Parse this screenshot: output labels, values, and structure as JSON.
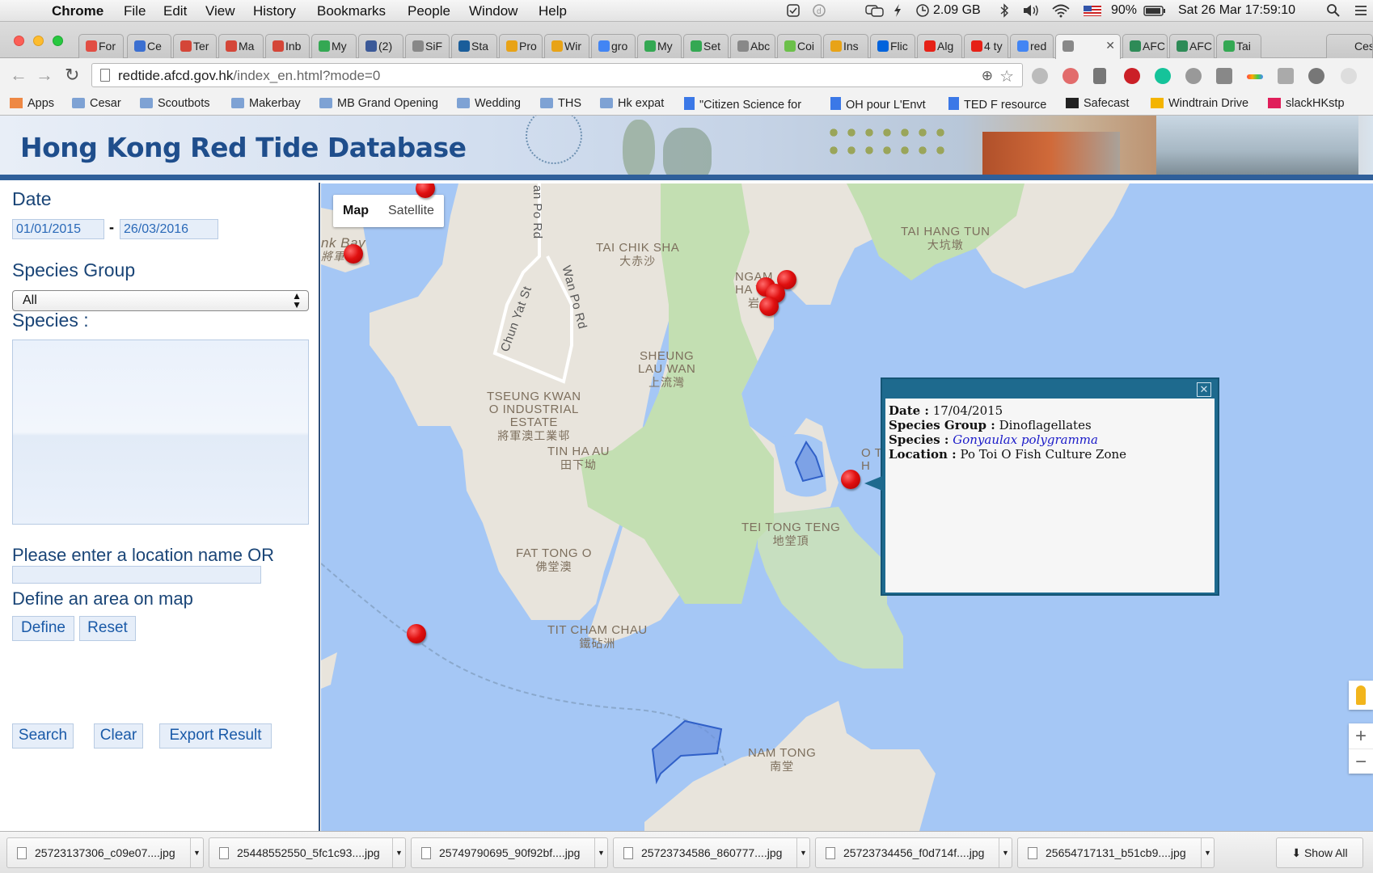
{
  "menubar": {
    "app": "Chrome",
    "items": [
      "File",
      "Edit",
      "View",
      "History",
      "Bookmarks",
      "People",
      "Window",
      "Help"
    ],
    "memory": "2.09 GB",
    "battery": "90%",
    "datetime": "Sat 26 Mar  17:59:10"
  },
  "tabs": [
    {
      "label": "For",
      "color": "#e14d43"
    },
    {
      "label": "Ce",
      "color": "#3b6fd1"
    },
    {
      "label": "Ter",
      "color": "#d44638"
    },
    {
      "label": "Ma",
      "color": "#d44638"
    },
    {
      "label": "Inb",
      "color": "#d44638"
    },
    {
      "label": "My",
      "color": "#34a853"
    },
    {
      "label": "(2)",
      "color": "#3b5998"
    },
    {
      "label": "SiF",
      "color": "#888888"
    },
    {
      "label": "Sta",
      "color": "#1a5d9a"
    },
    {
      "label": "Pro",
      "color": "#e8a317"
    },
    {
      "label": "Wir",
      "color": "#e8a317"
    },
    {
      "label": "gro",
      "color": "#4285f4"
    },
    {
      "label": "My",
      "color": "#34a853"
    },
    {
      "label": "Set",
      "color": "#34a853"
    },
    {
      "label": "Abc",
      "color": "#888888"
    },
    {
      "label": "Coi",
      "color": "#6cc04a"
    },
    {
      "label": "Ins",
      "color": "#e8a317"
    },
    {
      "label": "Flic",
      "color": "#0063dc"
    },
    {
      "label": "Alg",
      "color": "#e62117"
    },
    {
      "label": "4 ty",
      "color": "#e62117"
    },
    {
      "label": "red",
      "color": "#4285f4"
    },
    {
      "label": "",
      "color": "#888888",
      "active": true
    },
    {
      "label": "AFC",
      "color": "#2e8b57"
    },
    {
      "label": "AFC",
      "color": "#2e8b57"
    },
    {
      "label": "Tai",
      "color": "#34a853"
    }
  ],
  "tab_overflow_label": "Ces",
  "toolbar": {
    "url_host": "redtide.afcd.gov.hk",
    "url_path": "/index_en.html?mode=0"
  },
  "bookmarks": [
    {
      "label": "Apps",
      "type": "apps"
    },
    {
      "label": "Cesar",
      "type": "folder"
    },
    {
      "label": "Scoutbots",
      "type": "folder"
    },
    {
      "label": "Makerbay",
      "type": "folder"
    },
    {
      "label": "MB Grand Opening",
      "type": "folder"
    },
    {
      "label": "Wedding",
      "type": "folder"
    },
    {
      "label": "THS",
      "type": "folder"
    },
    {
      "label": "Hk expat",
      "type": "folder"
    },
    {
      "label": "\"Citizen Science for",
      "type": "doc"
    },
    {
      "label": "OH pour L'Envt",
      "type": "doc"
    },
    {
      "label": "TED F resource",
      "type": "doc"
    },
    {
      "label": "Safecast",
      "type": "safecast"
    },
    {
      "label": "Windtrain Drive",
      "type": "drive"
    },
    {
      "label": "slackHKstp",
      "type": "slack"
    }
  ],
  "site": {
    "title": "Hong Kong Red Tide Database"
  },
  "sidebar": {
    "date_label": "Date",
    "date_from": "01/01/2015",
    "date_sep": "-",
    "date_to": "26/03/2016",
    "species_group_label": "Species Group",
    "species_group_value": "All",
    "species_label": "Species :",
    "location_label": "Please enter a location name OR",
    "location_value": "",
    "area_label": "Define an area on map",
    "define_btn": "Define",
    "reset_btn": "Reset",
    "search_btn": "Search",
    "clear_btn": "Clear",
    "export_btn": "Export Result"
  },
  "map": {
    "type_map": "Map",
    "type_satellite": "Satellite",
    "labels": {
      "bay_en": "nk Bay",
      "bay_zh": "將軍",
      "road1": "an Po Rd",
      "road2": "Wan Po Rd",
      "road3": "Chun Yat St",
      "taichiksha_en": "TAI CHIK SHA",
      "taichiksha_zh": "大赤沙",
      "ngam_en1": "NGAM",
      "ngam_en2": "HA T",
      "ngam_zh": "岩",
      "taihang_en": "TAI HANG TUN",
      "taihang_zh": "大坑墩",
      "sheung_en1": "SHEUNG",
      "sheung_en2": "LAU WAN",
      "sheung_zh": "上流灣",
      "tko_en1": "TSEUNG KWAN",
      "tko_en2": "O INDUSTRIAL",
      "tko_en3": "ESTATE",
      "tko_zh": "將軍澳工業邨",
      "tinha_en": "TIN HA AU",
      "tinha_zh": "田下坳",
      "teitong_en": "TEI TONG TENG",
      "teitong_zh": "地堂頂",
      "fattong_en": "FAT TONG O",
      "fattong_zh": "佛堂澳",
      "titcham_en": "TIT CHAM CHAU",
      "titcham_zh": "鐵砧洲",
      "namtong_en": "NAM TONG",
      "namtong_zh": "南堂",
      "potoi_partial1": "O T",
      "potoi_partial2": "H"
    }
  },
  "infowindow": {
    "date_label": "Date :",
    "date_value": "17/04/2015",
    "group_label": "Species Group :",
    "group_value": "Dinoflagellates",
    "species_label": "Species :",
    "species_value": "Gonyaulax polygramma",
    "location_label": "Location :",
    "location_value": "Po Toi O Fish Culture Zone"
  },
  "downloads": [
    "25723137306_c09e07....jpg",
    "25448552550_5fc1c93....jpg",
    "25749790695_90f92bf....jpg",
    "25723734586_860777....jpg",
    "25723734456_f0d714f....jpg",
    "25654717131_b51cb9....jpg"
  ],
  "show_all": "Show All"
}
